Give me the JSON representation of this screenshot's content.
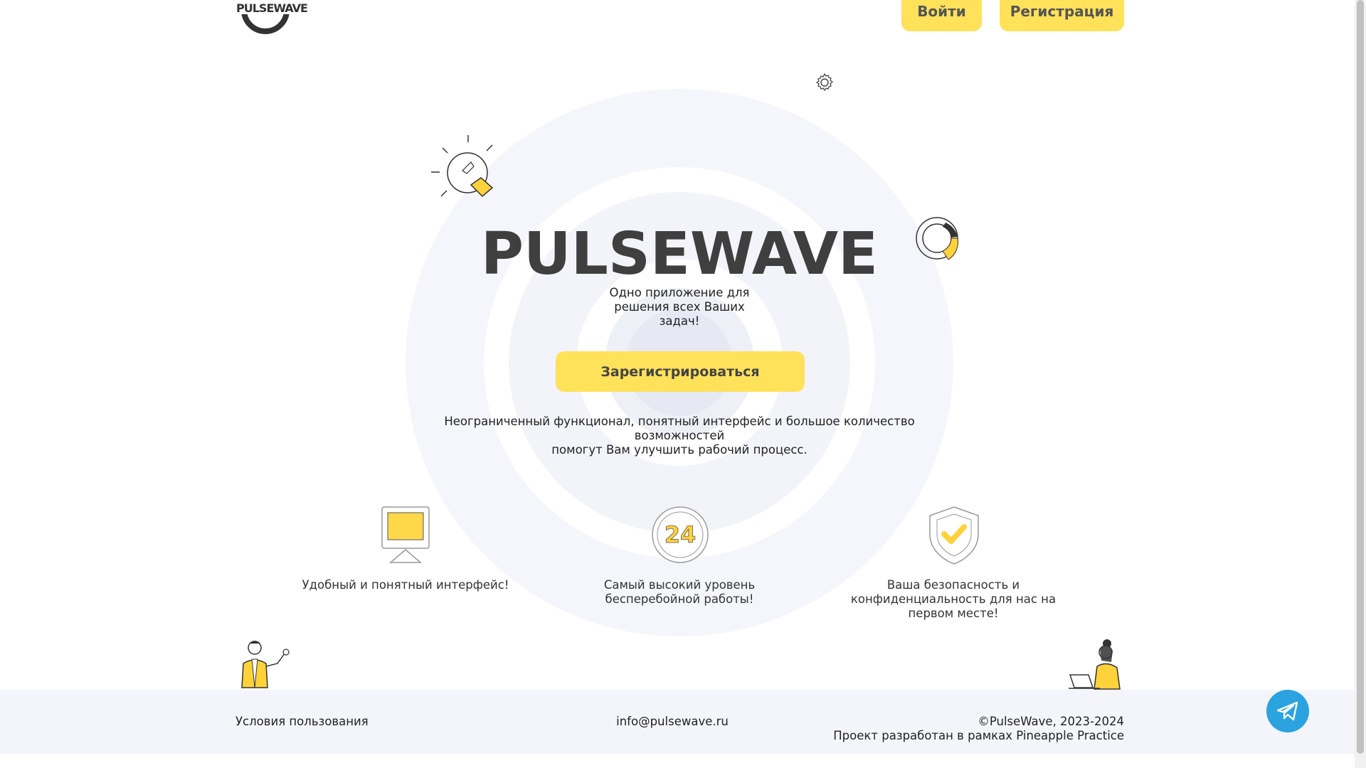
{
  "header": {
    "logo_text": "PULSEWAVE",
    "login_label": "Войти",
    "register_label": "Регистрация"
  },
  "hero": {
    "title": "PULSEWAVE",
    "subtitle_lines": [
      "Одно приложение для",
      "решения всех Ваших",
      "задач!"
    ],
    "cta_label": "Зарегистрироваться",
    "description_lines": [
      "Неограниченный функционал, понятный интерфейс и большое количество",
      "возможностей",
      "помогут Вам улучшить рабочий процесс."
    ]
  },
  "features": [
    {
      "icon": "monitor-icon",
      "lines": [
        "Удобный и понятный интерфейс!"
      ]
    },
    {
      "icon": "24-hours-icon",
      "badge": "24",
      "lines": [
        "Самый высокий уровень",
        "бесперебойной работы!"
      ]
    },
    {
      "icon": "shield-check-icon",
      "lines": [
        "Ваша безопасность и",
        "конфиденциальность для нас на",
        "первом месте!"
      ]
    }
  ],
  "footer": {
    "terms": "Условия пользования",
    "email": "info@pulsewave.ru",
    "copyright": "©PulseWave, 2023-2024",
    "credit": "Проект разработан в рамках Pineapple Practice"
  },
  "colors": {
    "accent": "#ffe15a",
    "telegram": "#2aa3e0",
    "footer_bg": "#f4f5fa",
    "rings": "#f1f3f9",
    "title": "#3f3f3f"
  }
}
